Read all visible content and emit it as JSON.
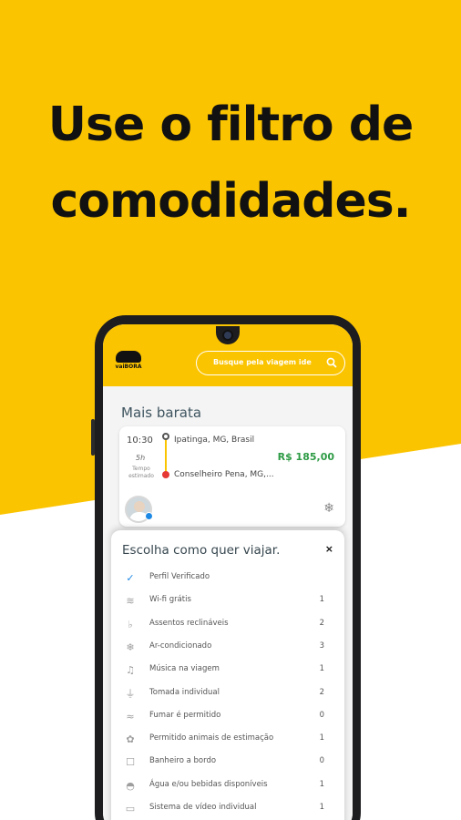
{
  "headline": {
    "line1": "Use o filtro de",
    "line2": "comodidades."
  },
  "app": {
    "logo_text": "vaiBORA",
    "search_placeholder": "Busque pela viagem ide"
  },
  "section": {
    "title": "Mais barata"
  },
  "trip": {
    "time": "10:30",
    "duration": "5h",
    "duration_label": "Tempo estimado",
    "origin": "Ipatinga, MG, Brasil",
    "destination": "Conselheiro Pena, MG,...",
    "price": "R$ 185,00"
  },
  "sheet": {
    "title": "Escolha como quer viajar.",
    "close": "×",
    "items": [
      {
        "label": "Perfil Verificado",
        "count": "",
        "icon": "verified-shield-icon"
      },
      {
        "label": "Wi-fi grátis",
        "count": "1",
        "icon": "wifi-icon"
      },
      {
        "label": "Assentos reclináveis",
        "count": "2",
        "icon": "seat-icon"
      },
      {
        "label": "Ar-condicionado",
        "count": "3",
        "icon": "snowflake-icon"
      },
      {
        "label": "Música na viagem",
        "count": "1",
        "icon": "music-icon"
      },
      {
        "label": "Tomada individual",
        "count": "2",
        "icon": "plug-icon"
      },
      {
        "label": "Fumar é permitido",
        "count": "0",
        "icon": "smoking-icon"
      },
      {
        "label": "Permitido animais de estimação",
        "count": "1",
        "icon": "paw-icon"
      },
      {
        "label": "Banheiro a bordo",
        "count": "0",
        "icon": "toilet-icon"
      },
      {
        "label": "Água e/ou bebidas disponíveis",
        "count": "1",
        "icon": "drink-icon"
      },
      {
        "label": "Sistema de vídeo individual",
        "count": "1",
        "icon": "video-icon"
      }
    ]
  },
  "colors": {
    "brand_yellow": "#fbc400",
    "price_green": "#2e9b45",
    "verified_blue": "#1e88e5"
  }
}
